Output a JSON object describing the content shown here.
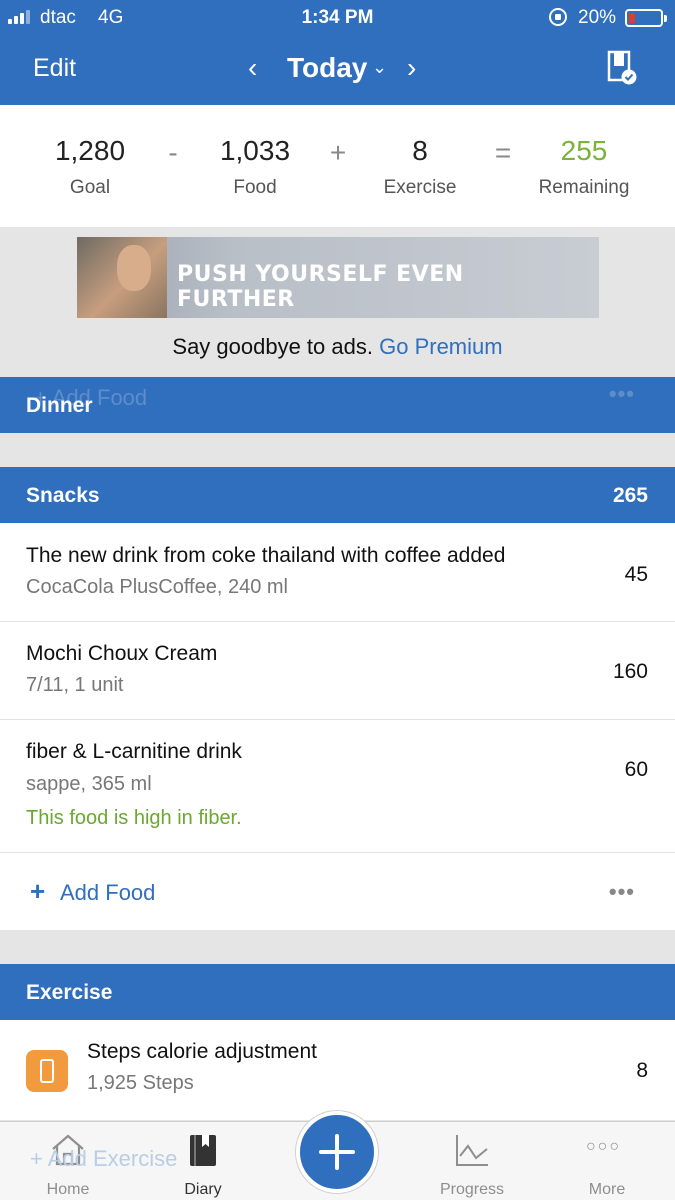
{
  "status_bar": {
    "carrier": "dtac",
    "network": "4G",
    "time": "1:34 PM",
    "battery_pct": "20%",
    "battery_level": 0.2
  },
  "nav": {
    "edit_label": "Edit",
    "prev_symbol": "‹",
    "date_label": "Today",
    "caret_symbol": "⌄",
    "next_symbol": "›",
    "diary_icon": "diary-check-icon"
  },
  "summary": {
    "goal": {
      "value": "1,280",
      "label": "Goal"
    },
    "minus": "-",
    "food": {
      "value": "1,033",
      "label": "Food"
    },
    "plus": "+",
    "exercise": {
      "value": "8",
      "label": "Exercise"
    },
    "equals": "=",
    "remaining": {
      "value": "255",
      "label": "Remaining"
    },
    "remaining_color": "#7bb13c"
  },
  "ad": {
    "banner_text": "PUSH YOURSELF EVEN FURTHER",
    "note": "Say goodbye to ads.",
    "link": "Go Premium"
  },
  "dinner": {
    "title": "Dinner",
    "ghost_add": "+ Add Food",
    "ghost_dots": "•••"
  },
  "snacks": {
    "title": "Snacks",
    "total": "265",
    "items": [
      {
        "name": "The new drink from coke thailand with coffee added",
        "detail": "CocaCola PlusCoffee, 240 ml",
        "calories": "45"
      },
      {
        "name": "Mochi Choux Cream",
        "detail": "7/11, 1 unit",
        "calories": "160"
      },
      {
        "name": "fiber & L-carnitine drink",
        "detail": "sappe, 365 ml",
        "note": "This food is high in fiber.",
        "calories": "60"
      }
    ],
    "add_plus": "+",
    "add_label": "Add Food",
    "more_dots": "•••"
  },
  "exercise": {
    "title": "Exercise",
    "items": [
      {
        "name": "Steps calorie adjustment",
        "detail": "1,925 Steps",
        "calories": "8",
        "icon": "phone-icon"
      }
    ],
    "ghost_add": "+ Add Exercise"
  },
  "tabbar": {
    "tabs": [
      {
        "label": "Home",
        "icon": "home-icon"
      },
      {
        "label": "Diary",
        "icon": "diary-icon",
        "active": true
      },
      {
        "label": "Progress",
        "icon": "progress-chart-icon"
      },
      {
        "label": "More",
        "icon": "more-dots-icon"
      }
    ],
    "more_symbol": "○○○"
  },
  "colors": {
    "brand_blue": "#2f6fbd",
    "positive_green": "#6aa832",
    "step_orange": "#f19a3e"
  }
}
